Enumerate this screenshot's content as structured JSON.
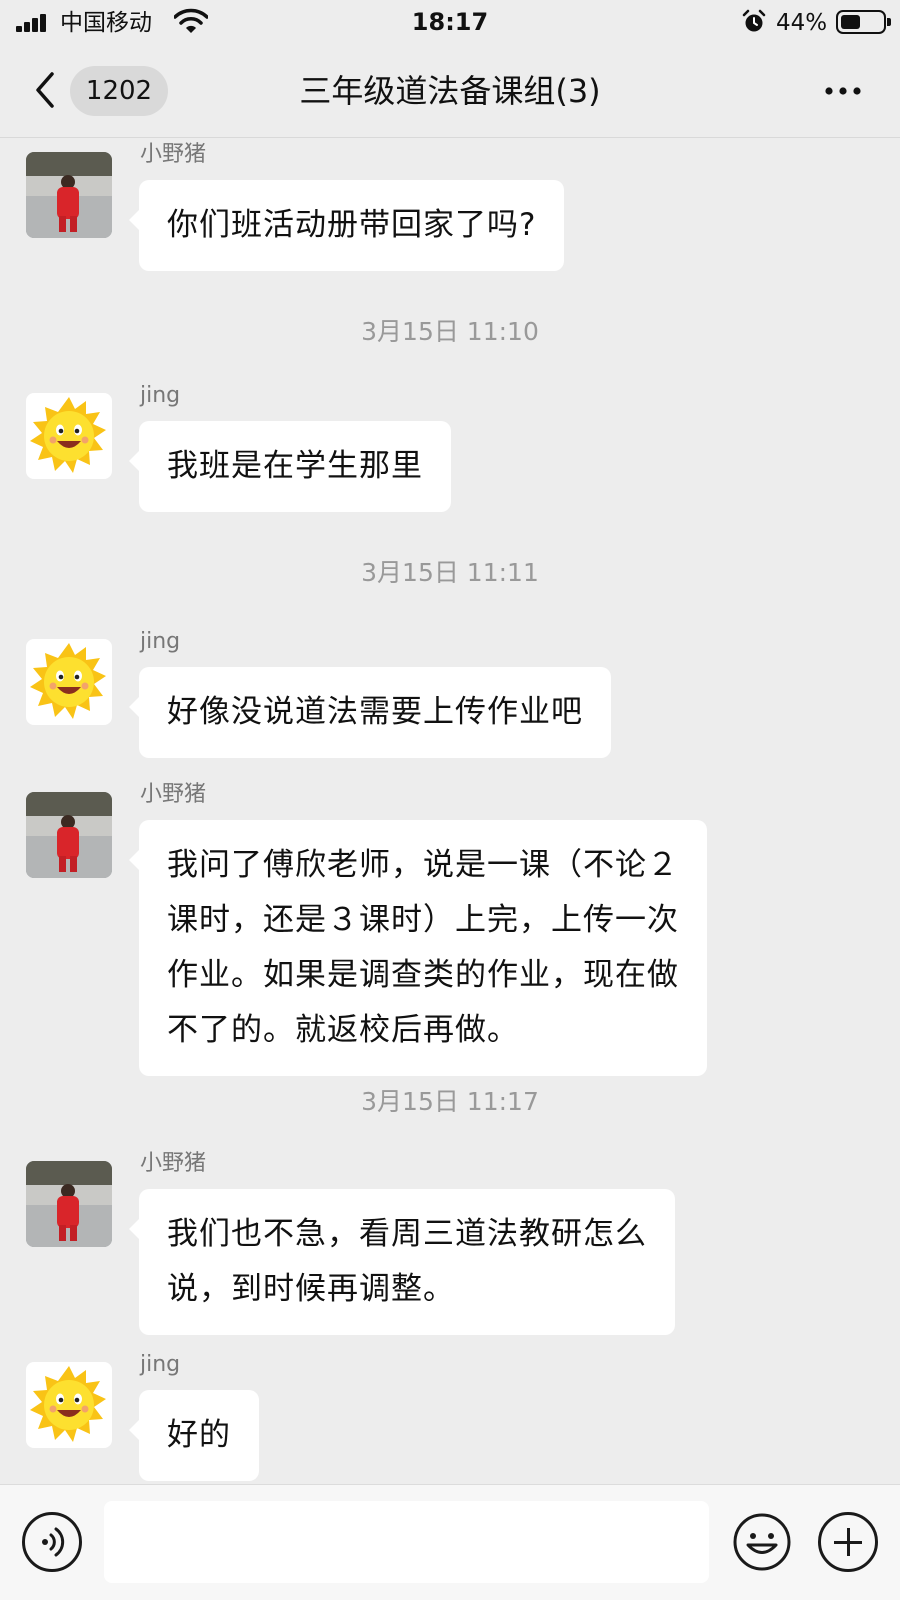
{
  "status_bar": {
    "carrier": "中国移动",
    "time": "18:17",
    "battery": "44%",
    "battery_level": 0.44,
    "icons": [
      "signal-icon",
      "wifi-icon",
      "alarm-icon",
      "battery-icon"
    ]
  },
  "nav": {
    "unread_count": "1202",
    "title": "三年级道法备课组(3)",
    "icons": [
      "back-chevron-icon",
      "more-dots-icon"
    ]
  },
  "messages": [
    {
      "sender": "小野猪",
      "text": "你们班活动册带回家了吗?"
    },
    {
      "time": "3月15日 11:10"
    },
    {
      "sender": "jing",
      "text": "我班是在学生那里"
    },
    {
      "time": "3月15日 11:11"
    },
    {
      "sender": "jing",
      "text": "好像没说道法需要上传作业吧"
    },
    {
      "sender": "小野猪",
      "lines": [
        "我问了傅欣老师，说是一课（不论２",
        "课时，还是３课时）上完，上传一次",
        "作业。如果是调查类的作业，现在做",
        "不了的。就返校后再做。"
      ]
    },
    {
      "time": "3月15日 11:17"
    },
    {
      "sender": "小野猪",
      "lines": [
        "我们也不急，看周三道法教研怎么",
        "说，到时候再调整。"
      ]
    },
    {
      "sender": "jing",
      "text": "好的"
    }
  ],
  "input_bar": {
    "icons": [
      "voice-icon",
      "emoji-icon",
      "plus-icon"
    ]
  },
  "colors": {
    "background": "#ededed",
    "bubble": "#ffffff",
    "text": "#111111",
    "meta_text": "#999999"
  }
}
